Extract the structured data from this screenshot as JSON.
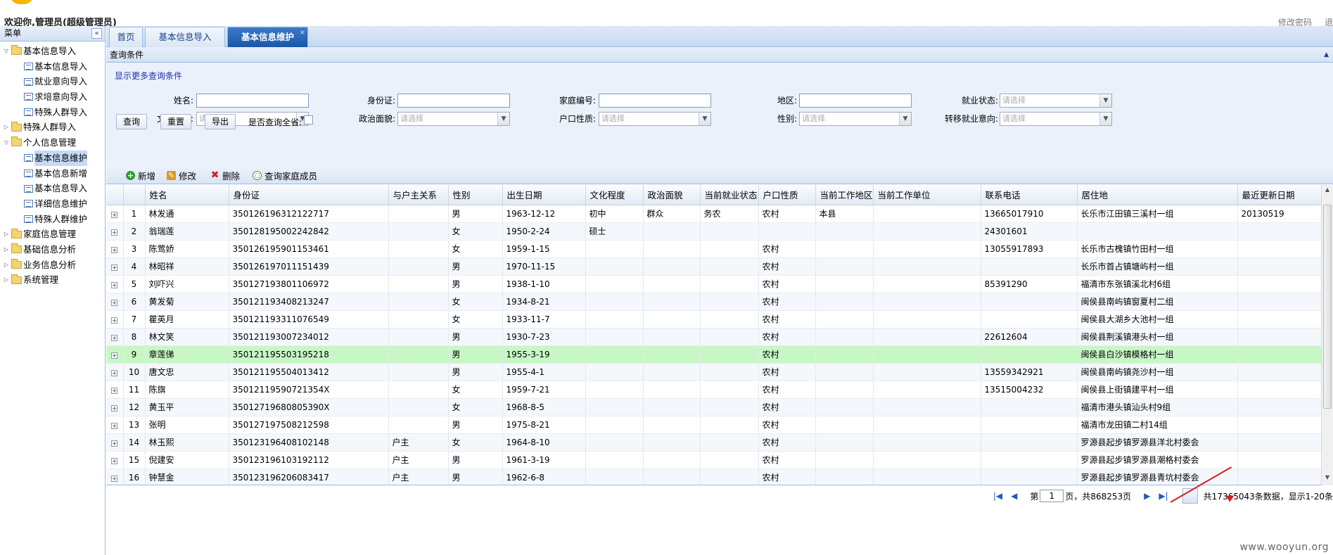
{
  "header": {
    "welcome": "欢迎你,管理员(超级管理员)",
    "change_password": "修改密码",
    "logout": "退"
  },
  "sidebar": {
    "title": "菜单",
    "collapse_glyph": "«",
    "tree": [
      {
        "label": "基本信息导入",
        "type": "folder",
        "open": true
      },
      {
        "label": "基本信息导入",
        "type": "leaf"
      },
      {
        "label": "就业意向导入",
        "type": "leaf"
      },
      {
        "label": "求培意向导入",
        "type": "leaf"
      },
      {
        "label": "特殊人群导入",
        "type": "leaf"
      },
      {
        "label": "特殊人群导入",
        "type": "folder",
        "open": false
      },
      {
        "label": "个人信息管理",
        "type": "folder",
        "open": true
      },
      {
        "label": "基本信息维护",
        "type": "leaf",
        "selected": true
      },
      {
        "label": "基本信息新增",
        "type": "leaf"
      },
      {
        "label": "基本信息导入",
        "type": "leaf"
      },
      {
        "label": "详细信息维护",
        "type": "leaf"
      },
      {
        "label": "特殊人群维护",
        "type": "leaf"
      },
      {
        "label": "家庭信息管理",
        "type": "folder",
        "open": false
      },
      {
        "label": "基础信息分析",
        "type": "folder",
        "open": false
      },
      {
        "label": "业务信息分析",
        "type": "folder",
        "open": false
      },
      {
        "label": "系统管理",
        "type": "folder",
        "open": false
      }
    ]
  },
  "tabs": [
    {
      "label": "首页"
    },
    {
      "label": "基本信息导入"
    },
    {
      "label": "基本信息维护",
      "active": true
    }
  ],
  "tab_close_glyph": "×",
  "query": {
    "title": "查询条件",
    "more_link": "显示更多查询条件",
    "fields_row1": [
      {
        "label": "姓名:"
      },
      {
        "label": "身份证:"
      },
      {
        "label": "家庭编号:"
      },
      {
        "label": "地区:"
      },
      {
        "label": "就业状态:",
        "select": true
      }
    ],
    "fields_row2": [
      {
        "label": "文化程度:"
      },
      {
        "label": "政治面貌:"
      },
      {
        "label": "户口性质:"
      },
      {
        "label": "性别:"
      },
      {
        "label": "转移就业意向:"
      }
    ],
    "select_placeholder": "请选择",
    "buttons": {
      "search": "查询",
      "reset": "重置",
      "export": "导出"
    },
    "all_province": "是否查询全省:"
  },
  "toolbar": {
    "add": "新增",
    "edit": "修改",
    "delete": "删除",
    "family": "查询家庭成员"
  },
  "table": {
    "columns": [
      "",
      "",
      "姓名",
      "身份证",
      "与户主关系",
      "性别",
      "出生日期",
      "文化程度",
      "政治面貌",
      "当前就业状态",
      "户口性质",
      "当前工作地区",
      "当前工作单位",
      "联系电话",
      "居住地",
      "最近更新日期"
    ],
    "rows": [
      [
        "1",
        "林发通",
        "350126196312122717",
        "",
        "男",
        "1963-12-12",
        "初中",
        "群众",
        "务农",
        "农村",
        "本县",
        "",
        "13665017910",
        "长乐市江田镇三溪村一组",
        "20130519"
      ],
      [
        "2",
        "翁瑞莲",
        "350128195002242842",
        "",
        "女",
        "1950-2-24",
        "硕士",
        "",
        "",
        "",
        "",
        "",
        "24301601",
        "",
        ""
      ],
      [
        "3",
        "陈莺娇",
        "350126195901153461",
        "",
        "女",
        "1959-1-15",
        "",
        "",
        "",
        "农村",
        "",
        "",
        "13055917893",
        "长乐市古槐镇竹田村一组",
        ""
      ],
      [
        "4",
        "林昭祥",
        "350126197011151439",
        "",
        "男",
        "1970-11-15",
        "",
        "",
        "",
        "农村",
        "",
        "",
        "",
        "长乐市首占镇塘屿村一组",
        ""
      ],
      [
        "5",
        "刘吓兴",
        "350127193801106972",
        "",
        "男",
        "1938-1-10",
        "",
        "",
        "",
        "农村",
        "",
        "",
        "85391290",
        "福清市东张镇溪北村6组",
        ""
      ],
      [
        "6",
        "黄发菊",
        "350121193408213247",
        "",
        "女",
        "1934-8-21",
        "",
        "",
        "",
        "农村",
        "",
        "",
        "",
        "闽侯县南屿镇窗夏村二组",
        ""
      ],
      [
        "7",
        "瞿英月",
        "350121193311076549",
        "",
        "女",
        "1933-11-7",
        "",
        "",
        "",
        "农村",
        "",
        "",
        "",
        "闽侯县大湖乡大池村一组",
        ""
      ],
      [
        "8",
        "林文笑",
        "350121193007234012",
        "",
        "男",
        "1930-7-23",
        "",
        "",
        "",
        "农村",
        "",
        "",
        "22612604",
        "闽侯县荆溪镇港头村一组",
        ""
      ],
      [
        "9",
        "章莲俤",
        "350121195503195218",
        "",
        "男",
        "1955-3-19",
        "",
        "",
        "",
        "农村",
        "",
        "",
        "",
        "闽侯县白沙镇模格村一组",
        ""
      ],
      [
        "10",
        "唐文忠",
        "350121195504013412",
        "",
        "男",
        "1955-4-1",
        "",
        "",
        "",
        "农村",
        "",
        "",
        "13559342921",
        "闽侯县南屿镇尧沙村一组",
        ""
      ],
      [
        "11",
        "陈旗",
        "35012119590721354X",
        "",
        "女",
        "1959-7-21",
        "",
        "",
        "",
        "农村",
        "",
        "",
        "13515004232",
        "闽侯县上街镇建平村一组",
        ""
      ],
      [
        "12",
        "黄玉平",
        "35012719680805390X",
        "",
        "女",
        "1968-8-5",
        "",
        "",
        "",
        "农村",
        "",
        "",
        "",
        "福清市港头镇汕头村9组",
        ""
      ],
      [
        "13",
        "张明",
        "350127197508212598",
        "",
        "男",
        "1975-8-21",
        "",
        "",
        "",
        "农村",
        "",
        "",
        "",
        "福清市龙田镇二村14组",
        ""
      ],
      [
        "14",
        "林玉熙",
        "350123196408102148",
        "户主",
        "女",
        "1964-8-10",
        "",
        "",
        "",
        "农村",
        "",
        "",
        "",
        "罗源县起步镇罗源县洋北村委会",
        ""
      ],
      [
        "15",
        "倪建安",
        "350123196103192112",
        "户主",
        "男",
        "1961-3-19",
        "",
        "",
        "",
        "农村",
        "",
        "",
        "",
        "罗源县起步镇罗源县潮格村委会",
        ""
      ],
      [
        "16",
        "钟慧金",
        "350123196206083417",
        "户主",
        "男",
        "1962-6-8",
        "",
        "",
        "",
        "农村",
        "",
        "",
        "",
        "罗源县起步镇罗源县青坑村委会",
        ""
      ]
    ],
    "highlight_row": 8,
    "expand_glyph": "+"
  },
  "pager": {
    "page_prefix": "第",
    "current_page": "1",
    "page_suffix": "页，共868253页",
    "summary": "共17365043条数据，显示1-20条"
  },
  "watermark": "www.wooyun.org",
  "colors": {
    "accent": "#1a56a6",
    "highlight": "#c8f7c5",
    "annotation_arrow": "#d52020"
  }
}
